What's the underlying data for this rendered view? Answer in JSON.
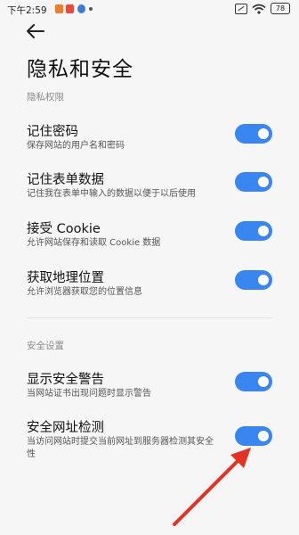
{
  "status_bar": {
    "time": "下午2:59",
    "battery": "78"
  },
  "page": {
    "title": "隐私和安全"
  },
  "privacy_section": {
    "header": "隐私权限",
    "items": [
      {
        "title": "记住密码",
        "desc": "保存网站的用户名和密码",
        "enabled": true
      },
      {
        "title": "记住表单数据",
        "desc": "记住我在表单中输入的数据以便于以后使用",
        "enabled": true
      },
      {
        "title": "接受 Cookie",
        "desc": "允许网站保存和读取 Cookie 数据",
        "enabled": true
      },
      {
        "title": "获取地理位置",
        "desc": "允许浏览器获取您的位置信息",
        "enabled": true
      }
    ]
  },
  "security_section": {
    "header": "安全设置",
    "items": [
      {
        "title": "显示安全警告",
        "desc": "当网站证书出现问题时显示警告",
        "enabled": true
      },
      {
        "title": "安全网址检测",
        "desc": "当访问网站时提交当前网址到服务器检测其安全性",
        "enabled": true
      }
    ]
  },
  "colors": {
    "toggle_on": "#3a86f0",
    "annotation_arrow": "#e53226"
  }
}
